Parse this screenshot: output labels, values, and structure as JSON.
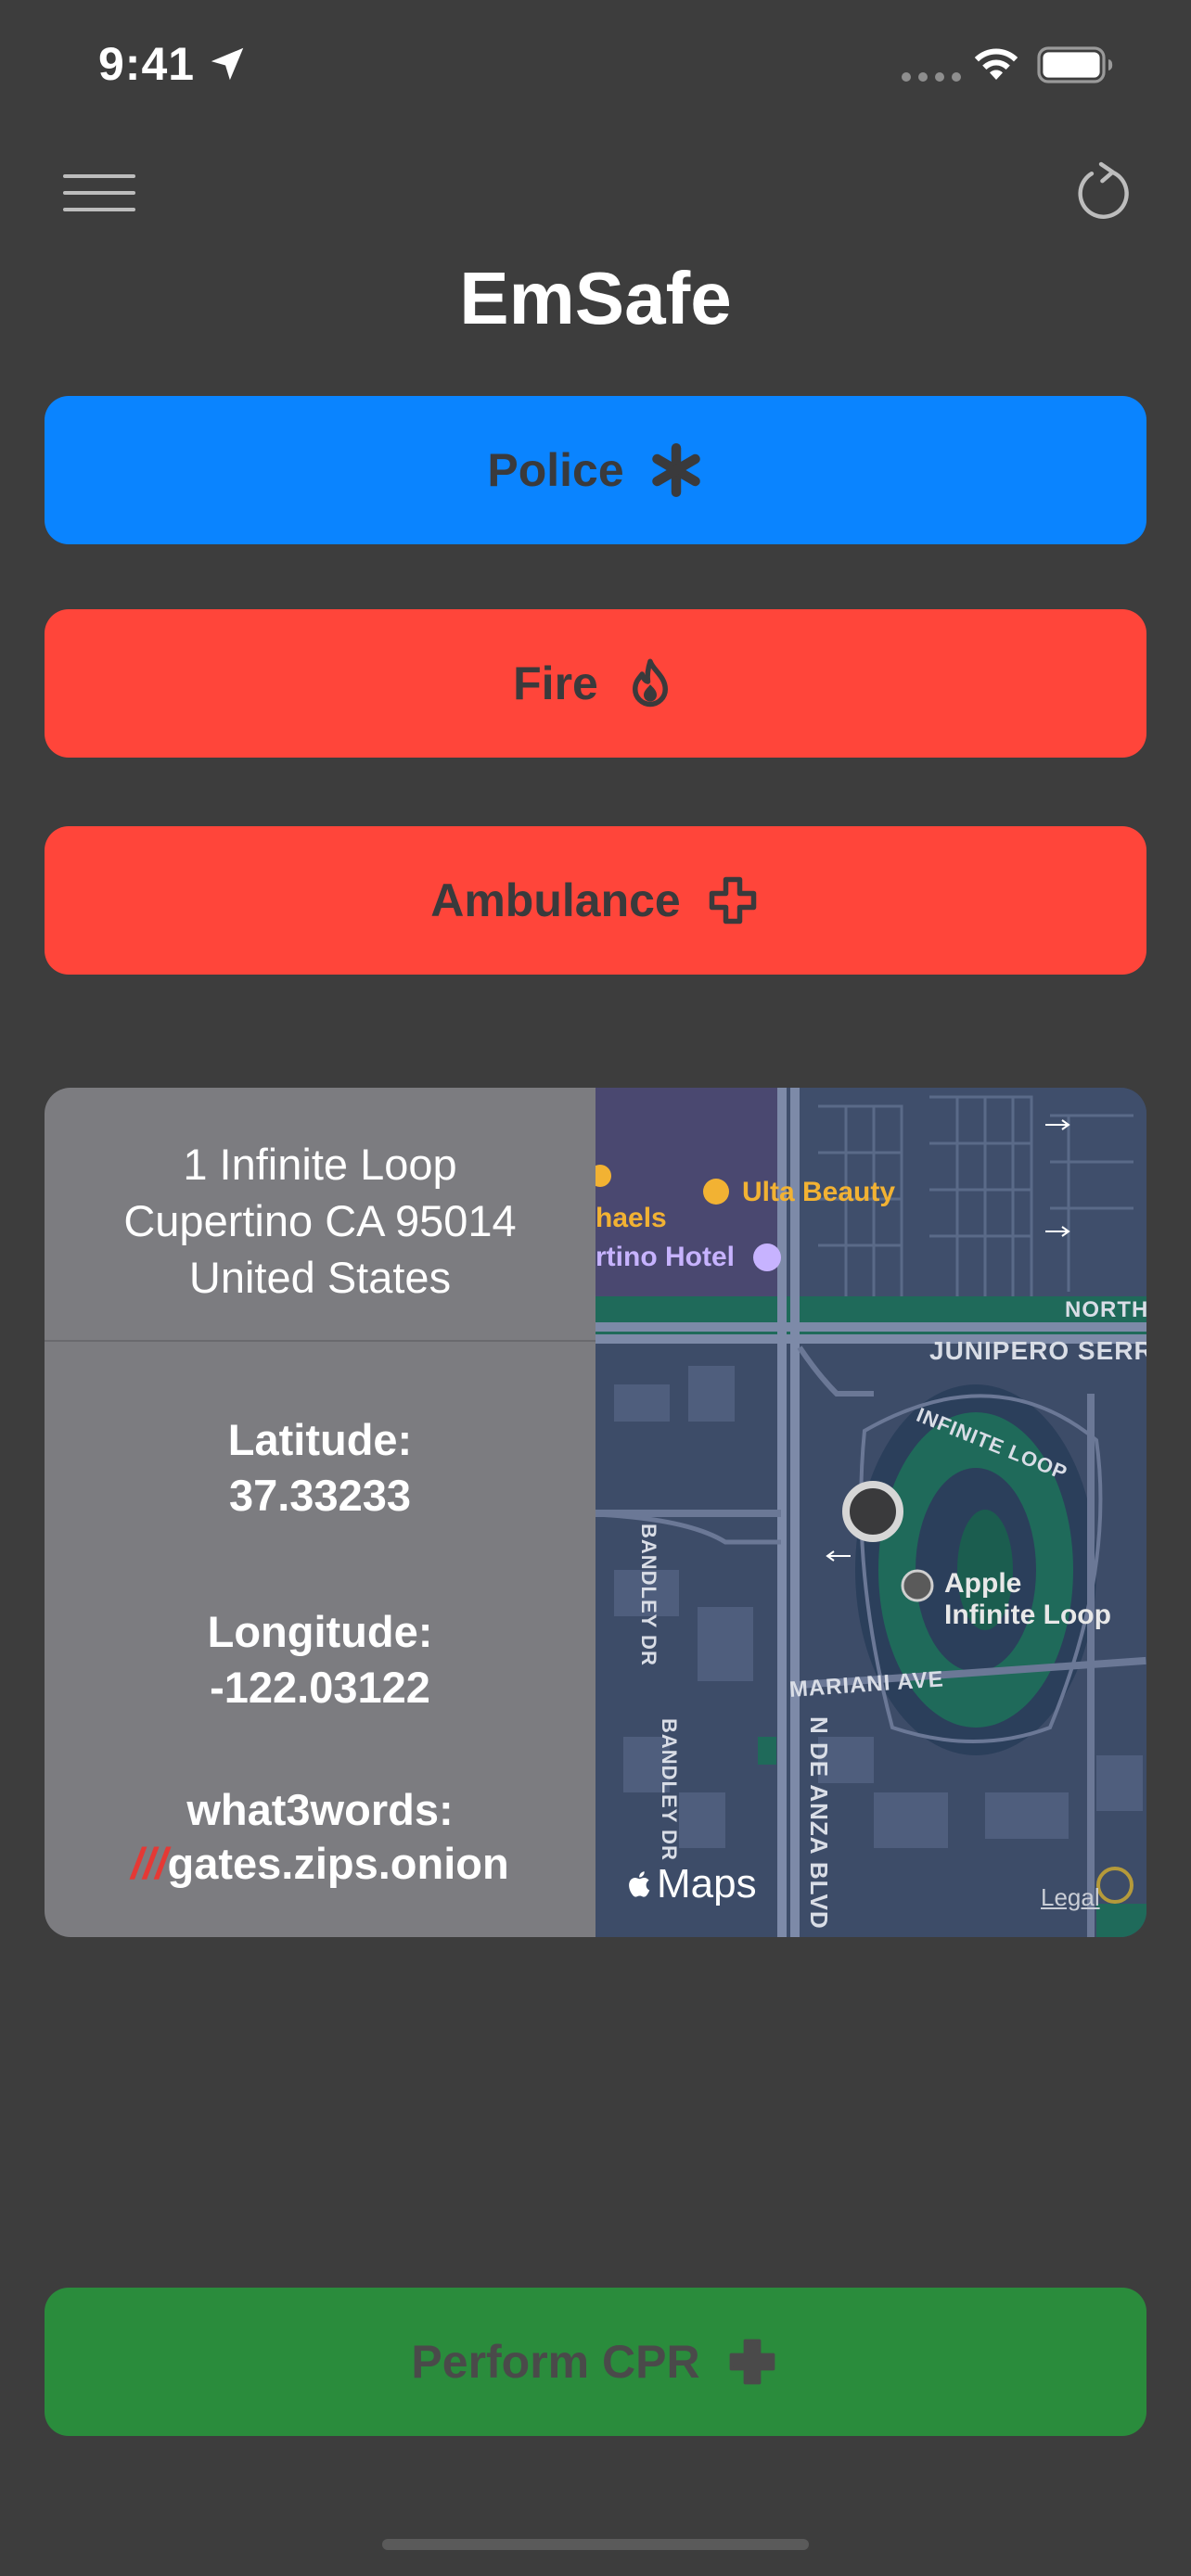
{
  "status_bar": {
    "time": "9:41",
    "location_icon": "location-arrow-icon",
    "signal_icon": "cellular-dots-icon",
    "wifi_icon": "wifi-icon",
    "battery_icon": "battery-icon"
  },
  "nav": {
    "menu_icon": "hamburger-menu-icon",
    "refresh_icon": "refresh-icon"
  },
  "app": {
    "title": "EmSafe"
  },
  "buttons": {
    "police": {
      "label": "Police",
      "icon": "asterisk-icon",
      "color": "#0a84ff"
    },
    "fire": {
      "label": "Fire",
      "icon": "flame-icon",
      "color": "#ff453a"
    },
    "ambulance": {
      "label": "Ambulance",
      "icon": "cross-outline-icon",
      "color": "#ff453a"
    },
    "cpr": {
      "label": "Perform CPR",
      "icon": "cross-filled-icon",
      "color": "#2a8c3c"
    }
  },
  "location": {
    "address_line1": "1 Infinite Loop",
    "address_line2": "Cupertino CA 95014",
    "address_line3": "United States",
    "latitude_label": "Latitude:",
    "latitude_value": "37.33233",
    "longitude_label": "Longitude:",
    "longitude_value": "-122.03122",
    "w3w_label": "what3words:",
    "w3w_prefix": "///",
    "w3w_value": "gates.zips.onion"
  },
  "map": {
    "poi_ulta": "Ulta Beauty",
    "poi_michaels": "haels",
    "poi_hotel": "rtino Hotel",
    "poi_apple_line1": "Apple",
    "poi_apple_line2": "Infinite Loop",
    "street_junipero": "JUNIPERO SERR",
    "street_north": "NORTH",
    "street_infinite_loop": "INFINITE LOOP",
    "street_bandley_1": "BANDLEY DR",
    "street_bandley_2": "BANDLEY DR",
    "street_mariani": "MARIANI AVE",
    "street_deanza": "N DE ANZA BLVD",
    "brand": "Maps",
    "legal": "Legal"
  }
}
